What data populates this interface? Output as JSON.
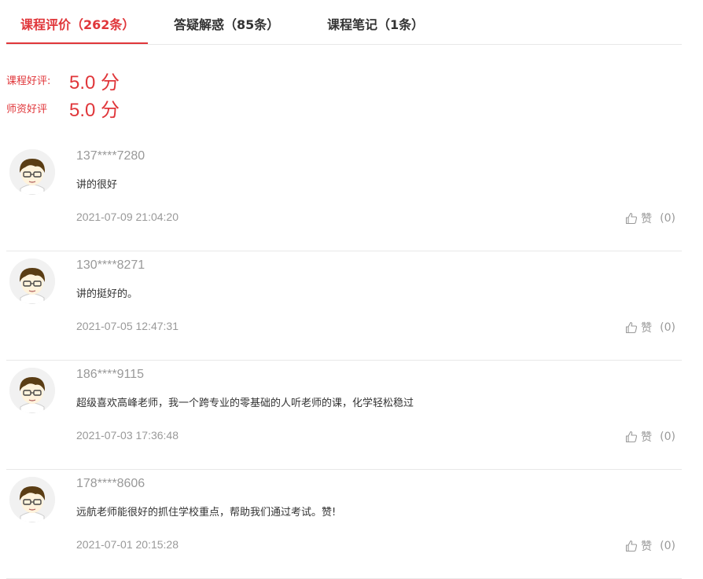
{
  "tabs": [
    {
      "label": "课程评价（262条）",
      "active": true
    },
    {
      "label": "答疑解惑（85条）",
      "active": false
    },
    {
      "label": "课程笔记（1条）",
      "active": false
    }
  ],
  "ratings": {
    "course_label": "课程好评:",
    "course_value": "5.0 分",
    "teacher_label": "师资好评",
    "teacher_value": "5.0 分"
  },
  "reviews": [
    {
      "user": "137****7280",
      "content": "讲的很好",
      "date": "2021-07-09 21:04:20",
      "like_label": "赞",
      "like_count": "(0)"
    },
    {
      "user": "130****8271",
      "content": "讲的挺好的。",
      "date": "2021-07-05 12:47:31",
      "like_label": "赞",
      "like_count": "(0)"
    },
    {
      "user": "186****9115",
      "content": "超级喜欢高峰老师，我一个跨专业的零基础的人听老师的课，化学轻松稳过",
      "date": "2021-07-03 17:36:48",
      "like_label": "赞",
      "like_count": "(0)"
    },
    {
      "user": "178****8606",
      "content": "远航老师能很好的抓住学校重点，帮助我们通过考试。赞!",
      "date": "2021-07-01 20:15:28",
      "like_label": "赞",
      "like_count": "(0)"
    }
  ],
  "colors": {
    "accent": "#e0363a",
    "muted": "#999999",
    "divider": "#e8e8e8"
  },
  "icons": {
    "avatar": "avatar-icon",
    "like": "thumbs-up-icon"
  }
}
